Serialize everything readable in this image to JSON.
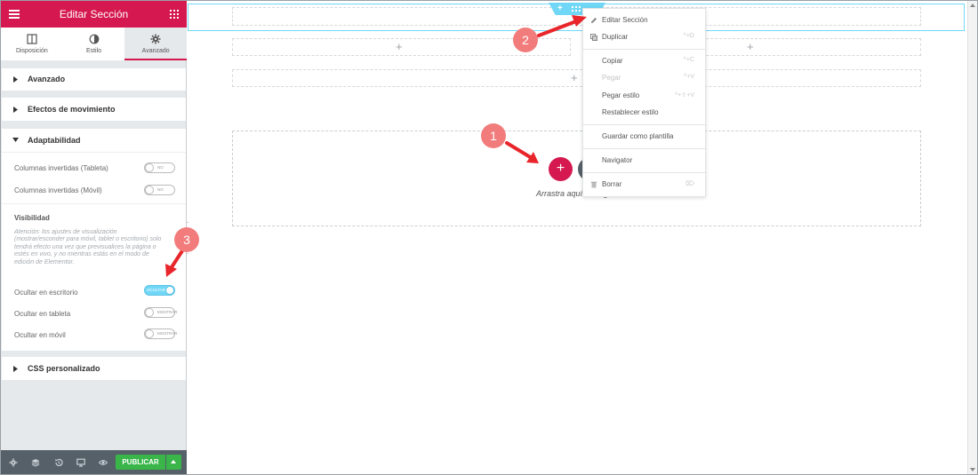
{
  "panel": {
    "title": "Editar Sección",
    "tabs": [
      {
        "label": "Disposición",
        "icon": "layout-icon"
      },
      {
        "label": "Estilo",
        "icon": "contrast-icon"
      },
      {
        "label": "Avanzado",
        "icon": "gear-icon",
        "active": true
      }
    ],
    "sections": {
      "avanzado": "Avanzado",
      "efectos": "Efectos de movimiento",
      "adaptabilidad": "Adaptabilidad",
      "css": "CSS personalizado"
    },
    "responsive": {
      "reverse_tablet_label": "Columnas invertidas (Tableta)",
      "reverse_tablet_toggle": "NO",
      "reverse_mobile_label": "Columnas invertidas (Móvil)",
      "reverse_mobile_toggle": "NO",
      "visibility_heading": "Visibilidad",
      "note": "Atención: los ajustes de visualización (mostrar/esconder para móvil, tablet o escritorio) solo tendrá efecto una vez que previsualices la página o estés en vivo, y no mientras estás en el modo de edición de Elementor.",
      "hide_desktop_label": "Ocultar en escritorio",
      "hide_desktop_toggle": "OCULTAR",
      "hide_tablet_label": "Ocultar en tableta",
      "hide_tablet_toggle": "MOSTRAR",
      "hide_mobile_label": "Ocultar en móvil",
      "hide_mobile_toggle": "MOSTRAR"
    },
    "footer": {
      "publish_label": "PUBLICAR"
    }
  },
  "canvas": {
    "drop_text": "Arrastra aquí",
    "drop_text_tail": "g"
  },
  "context_menu": {
    "items": [
      {
        "label": "Editar Sección",
        "shortcut": ""
      },
      {
        "label": "Duplicar",
        "shortcut": "^+D"
      },
      {
        "label": "Copiar",
        "shortcut": "^+C"
      },
      {
        "label": "Pegar",
        "shortcut": "^+V",
        "disabled": true
      },
      {
        "label": "Pegar estilo",
        "shortcut": "^+⇧+V"
      },
      {
        "label": "Restablecer estilo",
        "shortcut": ""
      },
      {
        "label": "Guardar como plantilla",
        "shortcut": ""
      },
      {
        "label": "Navigator",
        "shortcut": ""
      },
      {
        "label": "Borrar",
        "shortcut": "⌦"
      }
    ]
  },
  "annotations": [
    "1",
    "2",
    "3"
  ],
  "colors": {
    "brand": "#d5184f",
    "accent": "#71d7f7",
    "publish": "#39b54a",
    "footer": "#556068",
    "badge": "#f27c7c",
    "arrow": "#e8252b"
  }
}
